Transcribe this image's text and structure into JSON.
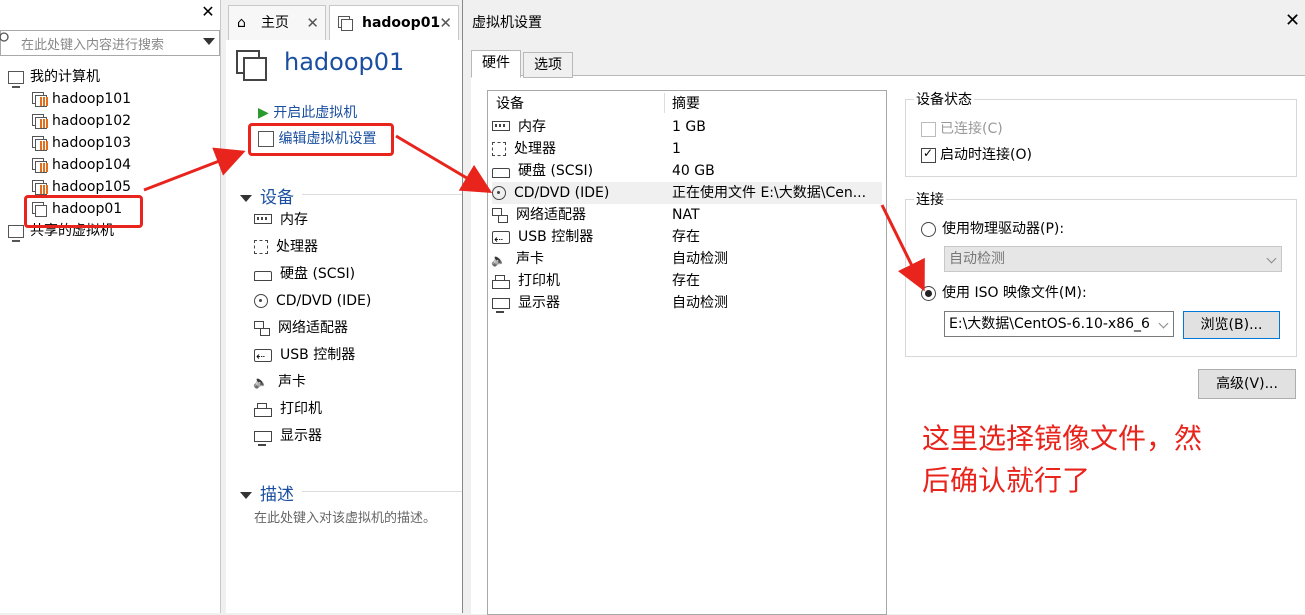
{
  "library": {
    "search_placeholder": "在此处键入内容进行搜索",
    "root": "我的计算机",
    "vms": [
      "hadoop101",
      "hadoop102",
      "hadoop103",
      "hadoop104",
      "hadoop105",
      "hadoop01"
    ],
    "shared": "共享的虚拟机"
  },
  "tabs": [
    {
      "label": "主页"
    },
    {
      "label": "hadoop01"
    }
  ],
  "summary": {
    "title": "hadoop01",
    "start_link": "开启此虚拟机",
    "edit_link": "编辑虚拟机设置",
    "devices_heading": "设备",
    "devices": [
      "内存",
      "处理器",
      "硬盘 (SCSI)",
      "CD/DVD (IDE)",
      "网络适配器",
      "USB 控制器",
      "声卡",
      "打印机",
      "显示器"
    ],
    "description_heading": "描述",
    "description_placeholder": "在此处键入对该虚拟机的描述。"
  },
  "dialog": {
    "title": "虚拟机设置",
    "tabs": [
      "硬件",
      "选项"
    ],
    "list_headers": {
      "device": "设备",
      "summary": "摘要"
    },
    "rows": [
      {
        "device": "内存",
        "summary": "1 GB"
      },
      {
        "device": "处理器",
        "summary": "1"
      },
      {
        "device": "硬盘 (SCSI)",
        "summary": "40 GB"
      },
      {
        "device": "CD/DVD (IDE)",
        "summary": "正在使用文件 E:\\大数据\\Cen..."
      },
      {
        "device": "网络适配器",
        "summary": "NAT"
      },
      {
        "device": "USB 控制器",
        "summary": "存在"
      },
      {
        "device": "声卡",
        "summary": "自动检测"
      },
      {
        "device": "打印机",
        "summary": "存在"
      },
      {
        "device": "显示器",
        "summary": "自动检测"
      }
    ],
    "device_status": {
      "label": "设备状态",
      "connected": "已连接(C)",
      "connect_on_start": "启动时连接(O)"
    },
    "connection": {
      "label": "连接",
      "physical": "使用物理驱动器(P):",
      "physical_value": "自动检测",
      "iso": "使用 ISO 映像文件(M):",
      "iso_value": "E:\\大数据\\CentOS-6.10-x86_6",
      "browse": "浏览(B)...",
      "advanced": "高级(V)..."
    }
  },
  "annotation": [
    "这里选择镜像文件，然",
    "后确认就行了"
  ],
  "colors": {
    "annotation": "#e8241c",
    "link": "#1a4fa0"
  }
}
